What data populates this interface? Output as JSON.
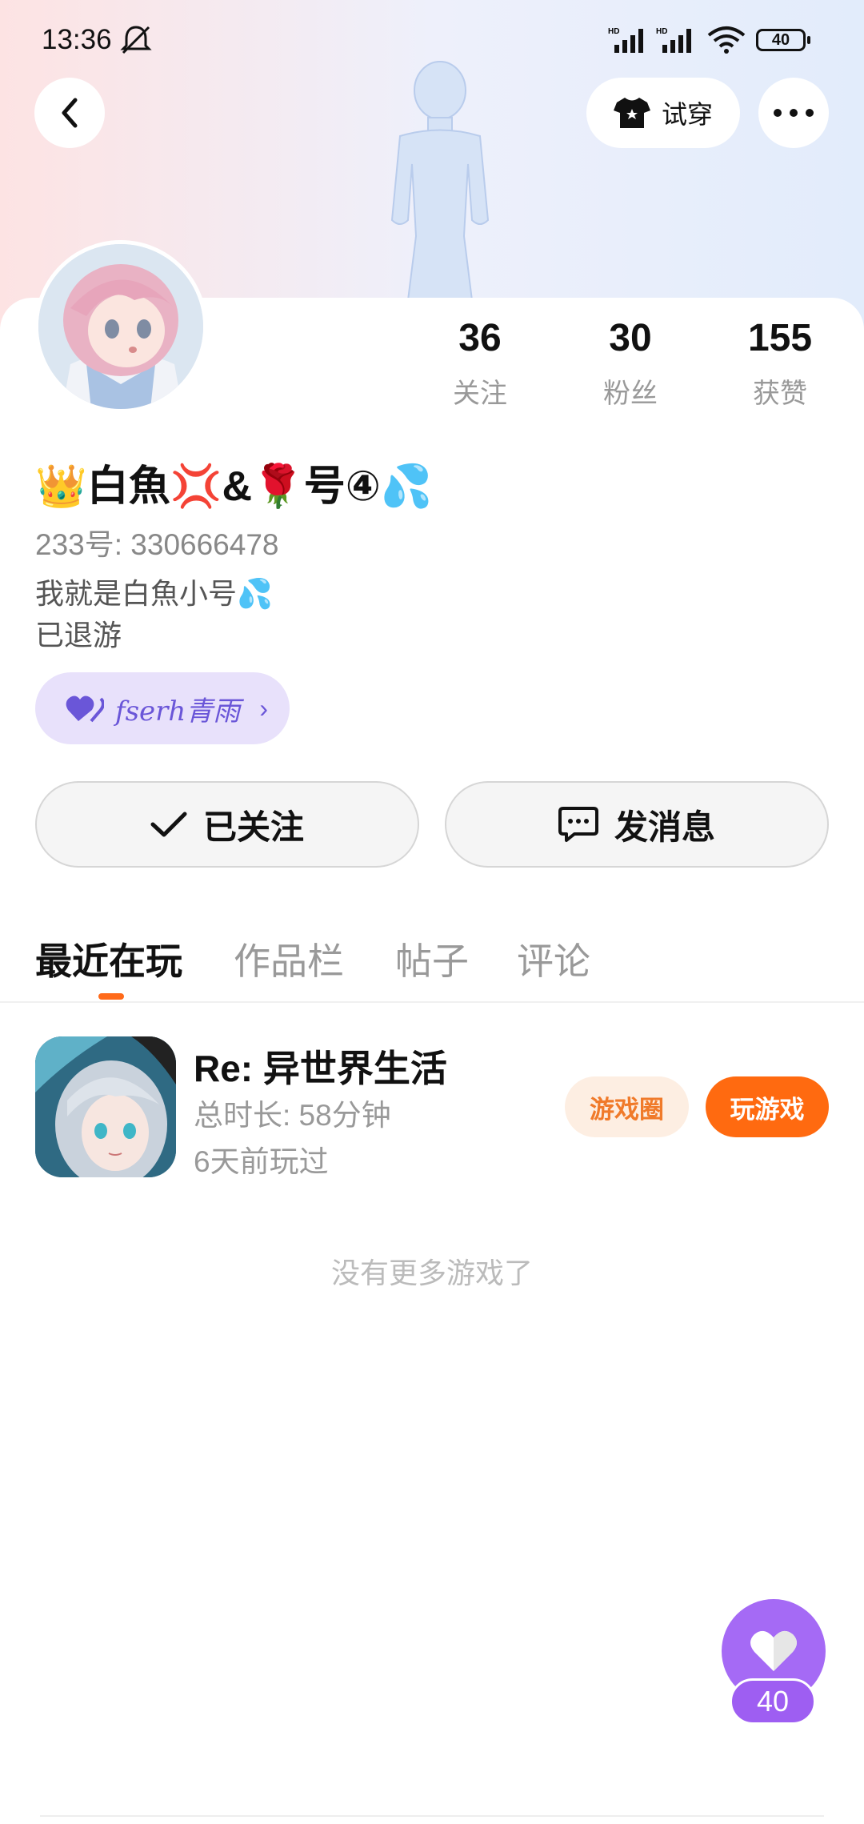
{
  "status_bar": {
    "time": "13:36",
    "battery": "40"
  },
  "header": {
    "try_on_label": "试穿"
  },
  "profile": {
    "stats": [
      {
        "value": "36",
        "label": "关注"
      },
      {
        "value": "30",
        "label": "粉丝"
      },
      {
        "value": "155",
        "label": "获赞"
      }
    ],
    "nickname": "👑白魚💢&🌹号④💦",
    "user_id": "233号: 330666478",
    "bio": "我就是白魚小号💦\n已退游",
    "cp_badge": {
      "name": "fserh青雨"
    }
  },
  "actions": {
    "follow_label": "已关注",
    "message_label": "发消息"
  },
  "tabs": [
    {
      "label": "最近在玩"
    },
    {
      "label": "作品栏"
    },
    {
      "label": "帖子"
    },
    {
      "label": "评论"
    }
  ],
  "games": [
    {
      "title": "Re: 异世界生活",
      "duration": "总时长: 58分钟",
      "last_played": "6天前玩过",
      "circle_label": "游戏圈",
      "play_label": "玩游戏"
    }
  ],
  "no_more_text": "没有更多游戏了",
  "like_fab": {
    "count": "40"
  }
}
